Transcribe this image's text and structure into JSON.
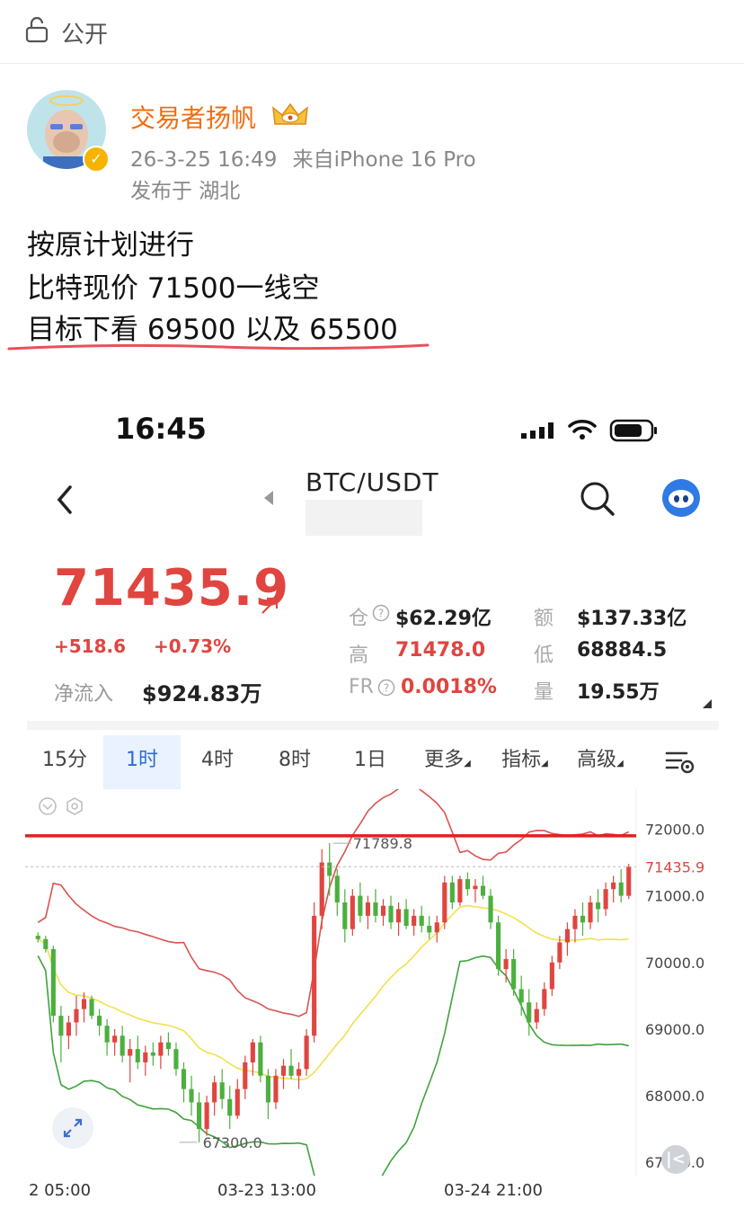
{
  "header": {
    "visibility_label": "公开"
  },
  "author": {
    "name": "交易者扬帆",
    "post_time": "26-3-25 16:49",
    "device": "来自iPhone 16 Pro",
    "location": "发布于 湖北"
  },
  "post": {
    "lines": [
      "按原计划进行",
      "比特现价 71500一线空",
      "目标下看 69500 以及 65500"
    ]
  },
  "screenshot": {
    "status_time": "16:45",
    "pair": "BTC/USDT",
    "price": "71435.9",
    "change_abs": "+518.6",
    "change_pct": "+0.73%",
    "inflow_label": "净流入",
    "inflow_value": "$924.83万",
    "stats": {
      "oi_label": "仓",
      "oi_value": "$62.29亿",
      "vol_label": "额",
      "vol_value": "$137.33亿",
      "high_label": "高",
      "high_value": "71478.0",
      "low_label": "低",
      "low_value": "68884.5",
      "fr_label": "FR",
      "fr_value": "0.0018%",
      "qty_label": "量",
      "qty_value": "19.55万"
    },
    "tabs": [
      "15分",
      "1时",
      "4时",
      "8时",
      "1日",
      "更多",
      "指标",
      "高级"
    ],
    "active_tab": "1时"
  },
  "colors": {
    "up": "#e0453f",
    "down": "#4caf3f",
    "accent": "#2f6bd8",
    "name": "#f26d0f",
    "mid_band": "#f2e04a"
  },
  "chart_data": {
    "type": "candlestick",
    "y_ticks": [
      "72000.0",
      "71000.0",
      "70000.0",
      "69000.0",
      "68000.0",
      "67000.0"
    ],
    "current_price_label": "71435.9",
    "ylim": [
      66800,
      72600
    ],
    "x_ticks": [
      "2 05:00",
      "03-23 13:00",
      "03-24 21:00"
    ],
    "annotations": {
      "high": "71789.8",
      "low": "67300.0"
    },
    "horizontal_line": 71900,
    "current_price": 71435.9,
    "candles": [
      [
        70400,
        70450,
        70300,
        70350
      ],
      [
        70350,
        70400,
        70150,
        70200
      ],
      [
        70200,
        70250,
        69100,
        69200
      ],
      [
        69200,
        69350,
        68500,
        68900
      ],
      [
        68900,
        69200,
        68700,
        69100
      ],
      [
        69100,
        69500,
        68900,
        69300
      ],
      [
        69300,
        69550,
        69100,
        69450
      ],
      [
        69450,
        69500,
        69150,
        69200
      ],
      [
        69200,
        69300,
        68900,
        69050
      ],
      [
        69050,
        69150,
        68600,
        68800
      ],
      [
        68800,
        69000,
        68600,
        68900
      ],
      [
        68900,
        69050,
        68500,
        68600
      ],
      [
        68600,
        68850,
        68200,
        68700
      ],
      [
        68700,
        68900,
        68400,
        68500
      ],
      [
        68500,
        68750,
        68300,
        68650
      ],
      [
        68650,
        68800,
        68450,
        68600
      ],
      [
        68600,
        68900,
        68400,
        68800
      ],
      [
        68800,
        68950,
        68600,
        68700
      ],
      [
        68700,
        68800,
        68300,
        68400
      ],
      [
        68400,
        68500,
        67900,
        68100
      ],
      [
        68100,
        68300,
        67700,
        67900
      ],
      [
        67900,
        68050,
        67300,
        67500
      ],
      [
        67500,
        68000,
        67400,
        67900
      ],
      [
        67900,
        68300,
        67700,
        68200
      ],
      [
        68200,
        68400,
        67800,
        67950
      ],
      [
        67950,
        68150,
        67500,
        67700
      ],
      [
        67700,
        68250,
        67650,
        68100
      ],
      [
        68100,
        68600,
        67950,
        68500
      ],
      [
        68500,
        68850,
        68300,
        68800
      ],
      [
        68800,
        68900,
        68200,
        68300
      ],
      [
        68300,
        68400,
        67650,
        67900
      ],
      [
        67900,
        68400,
        67800,
        68300
      ],
      [
        68300,
        68550,
        68100,
        68450
      ],
      [
        68450,
        68700,
        68250,
        68300
      ],
      [
        68300,
        68500,
        68100,
        68400
      ],
      [
        68400,
        69000,
        68300,
        68900
      ],
      [
        68900,
        70900,
        68800,
        70700
      ],
      [
        70700,
        71700,
        70500,
        71500
      ],
      [
        71500,
        71789.8,
        71000,
        71300
      ],
      [
        71300,
        71400,
        70700,
        70900
      ],
      [
        70900,
        71100,
        70300,
        70500
      ],
      [
        70500,
        71100,
        70400,
        71000
      ],
      [
        71000,
        71200,
        70600,
        70700
      ],
      [
        70700,
        71000,
        70500,
        70900
      ],
      [
        70900,
        71100,
        70600,
        70700
      ],
      [
        70700,
        70950,
        70550,
        70850
      ],
      [
        70850,
        71000,
        70500,
        70600
      ],
      [
        70600,
        70900,
        70400,
        70800
      ],
      [
        70800,
        70950,
        70500,
        70550
      ],
      [
        70550,
        70800,
        70400,
        70700
      ],
      [
        70700,
        70850,
        70450,
        70550
      ],
      [
        70550,
        70700,
        70350,
        70450
      ],
      [
        70450,
        70700,
        70300,
        70600
      ],
      [
        70600,
        71300,
        70500,
        71200
      ],
      [
        71200,
        71300,
        70800,
        70900
      ],
      [
        70900,
        71300,
        70850,
        71250
      ],
      [
        71250,
        71350,
        71000,
        71100
      ],
      [
        71100,
        71250,
        70900,
        71150
      ],
      [
        71150,
        71300,
        70950,
        71000
      ],
      [
        71000,
        71100,
        70500,
        70600
      ],
      [
        70600,
        70700,
        69800,
        69900
      ],
      [
        69900,
        70200,
        69700,
        70050
      ],
      [
        70050,
        70200,
        69500,
        69600
      ],
      [
        69600,
        69800,
        69200,
        69400
      ],
      [
        69400,
        69600,
        68900,
        69100
      ],
      [
        69100,
        69400,
        69000,
        69300
      ],
      [
        69300,
        69700,
        69200,
        69600
      ],
      [
        69600,
        70100,
        69500,
        70000
      ],
      [
        70000,
        70400,
        69900,
        70300
      ],
      [
        70300,
        70600,
        70100,
        70500
      ],
      [
        70500,
        70800,
        70300,
        70700
      ],
      [
        70700,
        70900,
        70400,
        70600
      ],
      [
        70600,
        71000,
        70500,
        70900
      ],
      [
        70900,
        71100,
        70600,
        70800
      ],
      [
        70800,
        71200,
        70700,
        71100
      ],
      [
        71100,
        71300,
        70900,
        71200
      ],
      [
        71200,
        71400,
        70900,
        71000
      ],
      [
        71000,
        71478,
        70950,
        71435.9
      ]
    ]
  }
}
